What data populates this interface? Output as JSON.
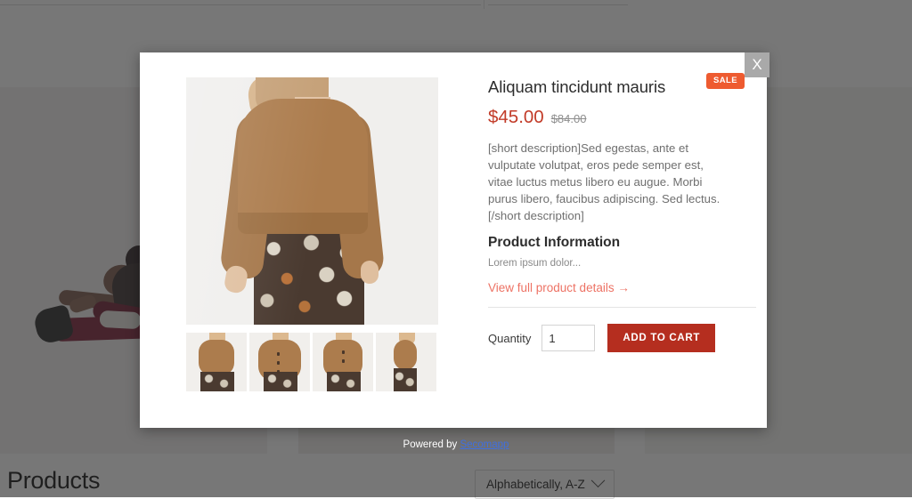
{
  "page": {
    "products_heading": "Products",
    "sort_selected": "Alphabetically, A-Z",
    "sort_options": [
      "Alphabetically, A-Z"
    ]
  },
  "modal": {
    "close_label": "X",
    "sale_badge": "SALE",
    "product_title": "Aliquam tincidunt mauris",
    "price_sale": "$45.00",
    "price_compare": "$84.00",
    "short_description": "[short description]Sed egestas, ante et vulputate volutpat, eros pede semper est, vitae luctus metus libero eu augue. Morbi purus libero, faucibus adipiscing. Sed lectus.[/short description]",
    "info_heading": "Product Information",
    "info_body": "Lorem ipsum dolor...",
    "details_link": "View full product details →",
    "quantity_label": "Quantity",
    "quantity_value": "1",
    "add_to_cart_label": "ADD TO CART",
    "thumbnails": [
      {
        "alt": "camel cardigan side view"
      },
      {
        "alt": "camel cardigan front buttoned"
      },
      {
        "alt": "camel cardigan front open"
      },
      {
        "alt": "camel cardigan full length"
      }
    ],
    "main_image_alt": "camel knit sweater back view with patterned skirt"
  },
  "footer": {
    "powered_prefix": "Powered by ",
    "powered_link": "Secomapp"
  },
  "colors": {
    "sale_badge": "#ee5b30",
    "sale_price": "#c23b28",
    "add_to_cart": "#b52e1f",
    "details_link": "#ed7264",
    "close_button": "#a9a9a9",
    "powered_link": "#3f6fe0",
    "overlay": "rgba(40,40,40,0.63)"
  }
}
